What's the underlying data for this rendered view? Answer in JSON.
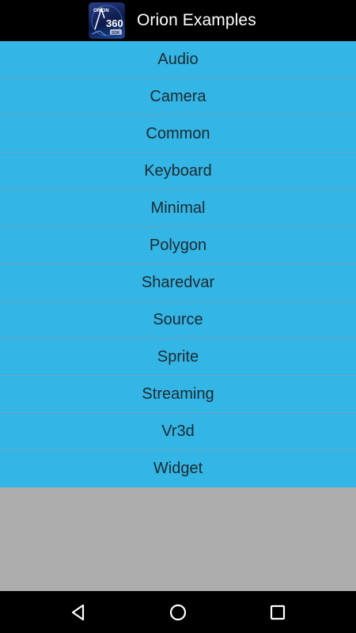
{
  "app": {
    "title": "Orion Examples",
    "icon": "orion-360-sdk-logo",
    "icon_text": "ORION 360 SDK",
    "header_color": "#000000",
    "list_color": "#33b5e5",
    "background_color": "#adadad"
  },
  "examples": [
    {
      "label": "Audio"
    },
    {
      "label": "Camera"
    },
    {
      "label": "Common"
    },
    {
      "label": "Keyboard"
    },
    {
      "label": "Minimal"
    },
    {
      "label": "Polygon"
    },
    {
      "label": "Sharedvar"
    },
    {
      "label": "Source"
    },
    {
      "label": "Sprite"
    },
    {
      "label": "Streaming"
    },
    {
      "label": "Vr3d"
    },
    {
      "label": "Widget"
    }
  ],
  "navigation": {
    "back_icon": "triangle-back-icon",
    "home_icon": "circle-home-icon",
    "recents_icon": "square-recents-icon"
  }
}
